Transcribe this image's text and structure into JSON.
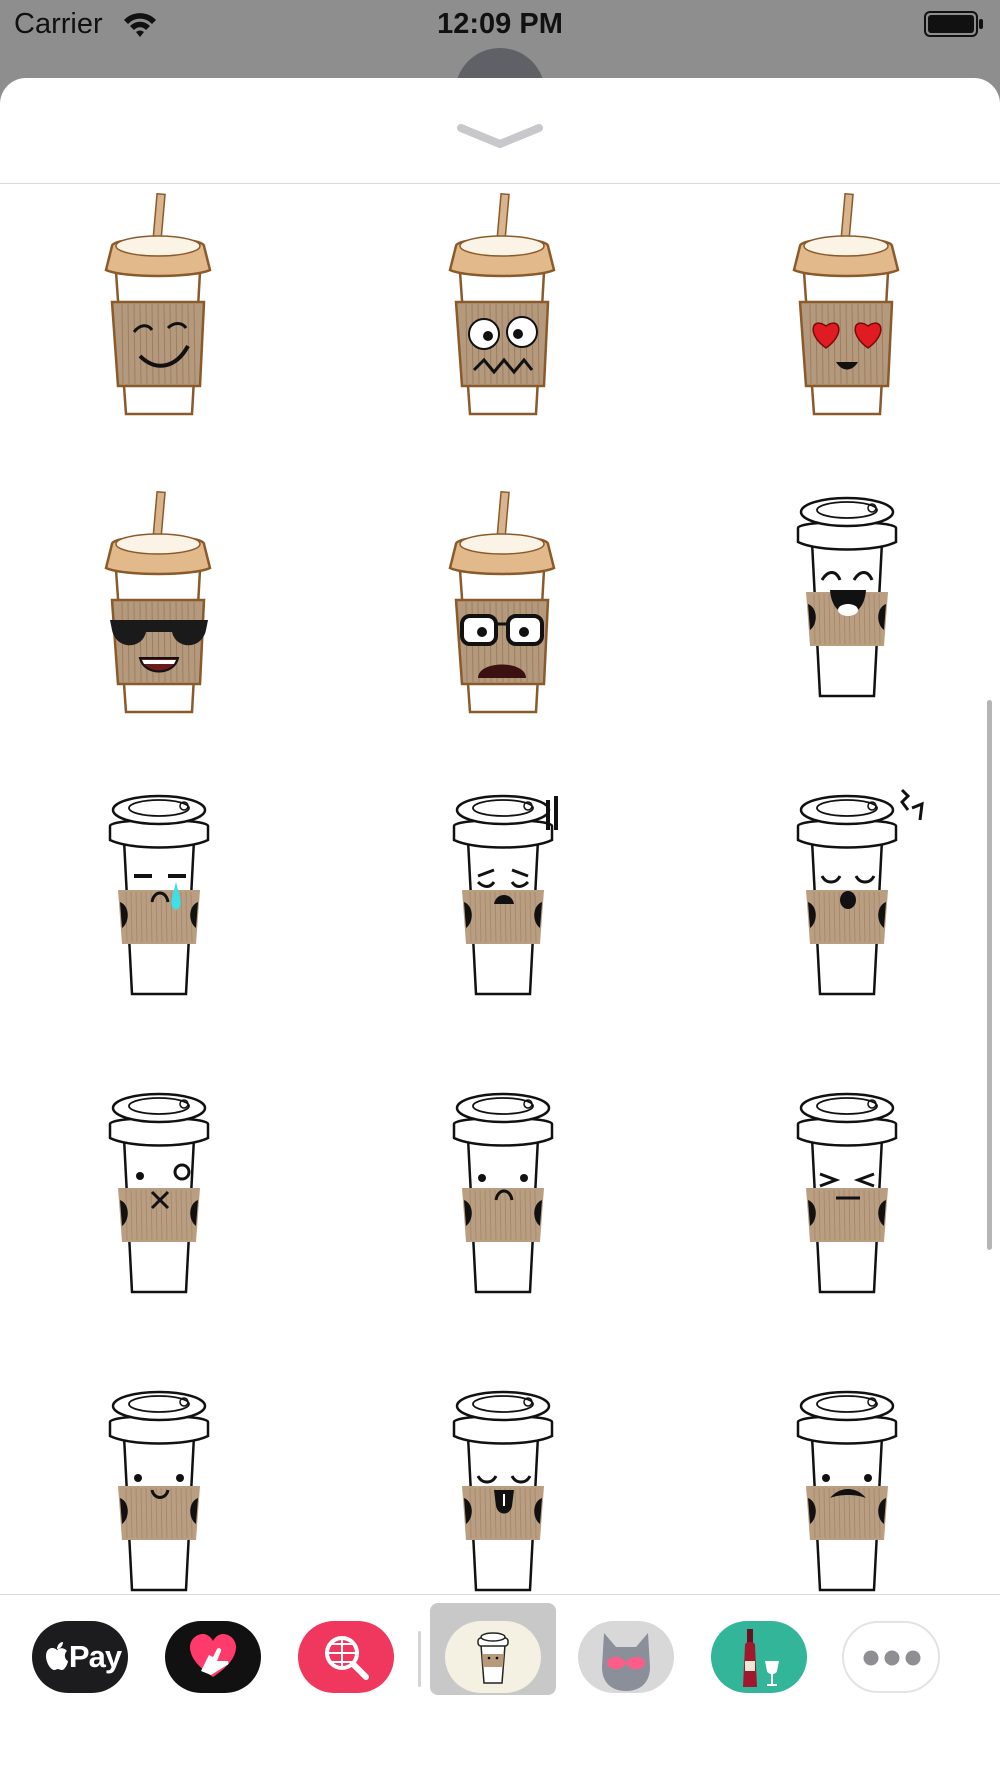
{
  "status_bar": {
    "carrier": "Carrier",
    "time": "12:09 PM"
  },
  "sheet": {
    "grabber_icon": "chevron-down-icon"
  },
  "stickers": [
    {
      "name": "brown-cup-smirk",
      "style": "brown",
      "face": "smirk"
    },
    {
      "name": "brown-cup-shocked",
      "style": "brown",
      "face": "shocked"
    },
    {
      "name": "brown-cup-heart-eyes",
      "style": "brown",
      "face": "hearts"
    },
    {
      "name": "brown-cup-sunglasses",
      "style": "brown",
      "face": "sunglasses"
    },
    {
      "name": "brown-cup-glasses",
      "style": "brown",
      "face": "glasses"
    },
    {
      "name": "white-cup-laughing",
      "style": "white",
      "face": "laugh"
    },
    {
      "name": "white-cup-crying",
      "style": "white",
      "face": "cry"
    },
    {
      "name": "white-cup-worried",
      "style": "white",
      "face": "worried"
    },
    {
      "name": "white-cup-singing",
      "style": "white",
      "face": "sing"
    },
    {
      "name": "white-cup-wink-x",
      "style": "white",
      "face": "x"
    },
    {
      "name": "white-cup-sad",
      "style": "white",
      "face": "sad"
    },
    {
      "name": "white-cup-squint",
      "style": "white",
      "face": "squint"
    },
    {
      "name": "white-cup-smile",
      "style": "white",
      "face": "smile"
    },
    {
      "name": "white-cup-tongue",
      "style": "white",
      "face": "tongue"
    },
    {
      "name": "white-cup-mustache",
      "style": "white",
      "face": "mustache"
    }
  ],
  "app_tray": {
    "apple_pay_label": "Pay",
    "apps": [
      {
        "name": "apple-pay",
        "icon": "apple-icon",
        "color": "#1c1c1e"
      },
      {
        "name": "digital-touch",
        "icon": "heart-hand-icon",
        "color": "#111111"
      },
      {
        "name": "image-search",
        "icon": "globe-search-icon",
        "color": "#f0375e"
      },
      {
        "name": "coffee-stickers",
        "icon": "coffee-cup-icon",
        "color": "#f4f1e2",
        "selected": true
      },
      {
        "name": "cat-stickers",
        "icon": "cat-icon",
        "color": "#d8d8d8"
      },
      {
        "name": "wine-stickers",
        "icon": "wine-bottle-icon",
        "color": "#33b59a"
      },
      {
        "name": "more-apps",
        "icon": "ellipsis-icon",
        "color": "#ffffff"
      }
    ]
  }
}
